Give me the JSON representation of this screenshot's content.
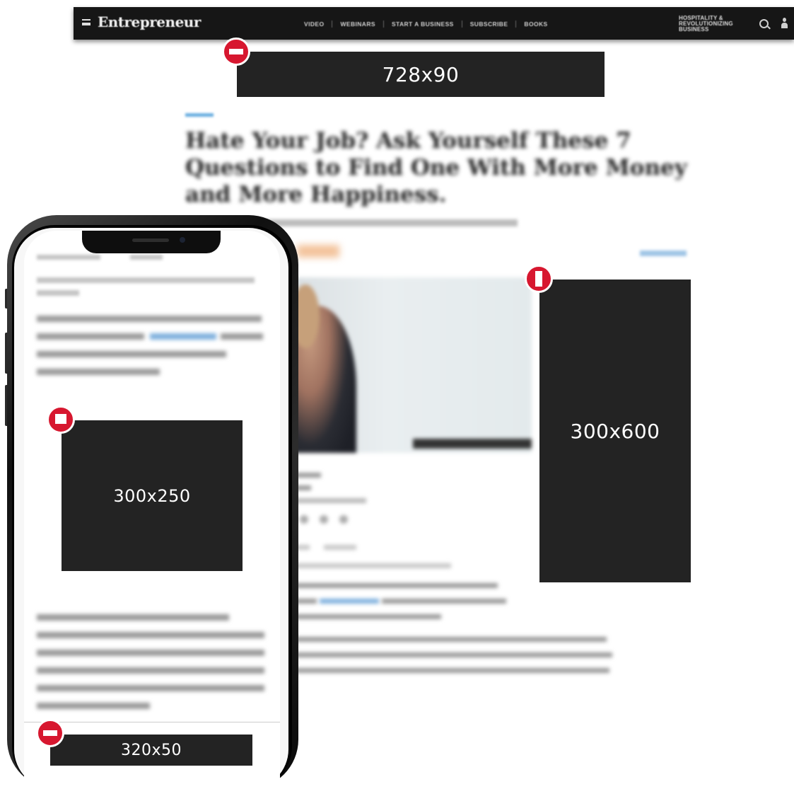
{
  "desktop": {
    "header": {
      "logo": "Entrepreneur",
      "nav": [
        "VIDEO",
        "WEBINARS",
        "START A BUSINESS",
        "SUBSCRIBE",
        "BOOKS"
      ],
      "promo_lines": [
        "HOSPITALITY &",
        "REVOLUTIONIZING",
        "BUSINESS"
      ]
    },
    "ads": {
      "leaderboard": "728x90",
      "skyscraper": "300x600"
    },
    "article": {
      "headline": "Hate Your Job? Ask Yourself These 7 Questions to Find One With More Money and More Happiness."
    }
  },
  "mobile": {
    "ads": {
      "rectangle": "300x250",
      "banner": "320x50"
    }
  }
}
